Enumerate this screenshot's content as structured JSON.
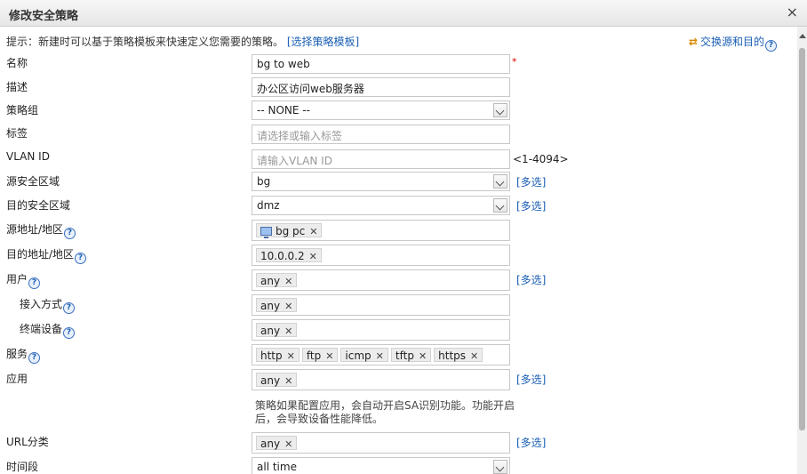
{
  "dialog": {
    "title": "修改安全策略",
    "close": "×"
  },
  "hint": {
    "text": "提示：新建时可以基于策略模板来快速定义您需要的策略。",
    "link": "[选择策略模板]"
  },
  "swap": {
    "icon": "⇄",
    "label": "交换源和目的",
    "help": "?"
  },
  "fields": {
    "name": {
      "label": "名称",
      "value": "bg to web",
      "required": "*"
    },
    "description": {
      "label": "描述",
      "value": "办公区访问web服务器"
    },
    "policy_group": {
      "label": "策略组",
      "value": "-- NONE --"
    },
    "tags": {
      "label": "标签",
      "placeholder": "请选择或输入标签"
    },
    "vlan": {
      "label": "VLAN ID",
      "placeholder": "请输入VLAN ID",
      "range": "<1-4094>"
    },
    "src_zone": {
      "label": "源安全区域",
      "value": "bg",
      "multi": "[多选]"
    },
    "dst_zone": {
      "label": "目的安全区域",
      "value": "dmz",
      "multi": "[多选]"
    },
    "src_addr": {
      "label": "源地址/地区",
      "help": "?",
      "tags": [
        "bg pc"
      ]
    },
    "dst_addr": {
      "label": "目的地址/地区",
      "help": "?",
      "tags": [
        "10.0.0.2"
      ]
    },
    "user": {
      "label": "用户",
      "help": "?",
      "tags": [
        "any"
      ],
      "multi": "[多选]"
    },
    "access_mode": {
      "label": "接入方式",
      "help": "?",
      "tags": [
        "any"
      ]
    },
    "terminal": {
      "label": "终端设备",
      "help": "?",
      "tags": [
        "any"
      ]
    },
    "service": {
      "label": "服务",
      "help": "?",
      "tags": [
        "http",
        "ftp",
        "icmp",
        "tftp",
        "https"
      ]
    },
    "application": {
      "label": "应用",
      "tags": [
        "any"
      ],
      "multi": "[多选]",
      "note": "策略如果配置应用，会自动开启SA识别功能。功能开启后，会导致设备性能降低。"
    },
    "url_category": {
      "label": "URL分类",
      "tags": [
        "any"
      ],
      "multi": "[多选]"
    },
    "schedule": {
      "label": "时间段",
      "value": "all time"
    }
  }
}
